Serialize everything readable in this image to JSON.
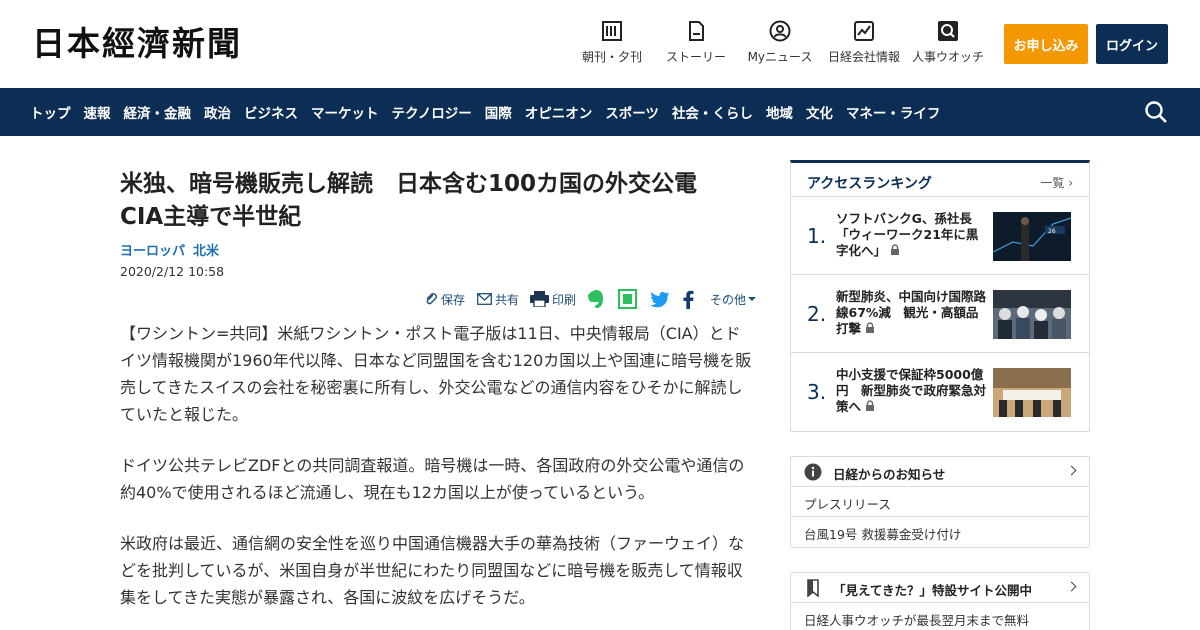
{
  "header": {
    "logo": "日本經濟新聞",
    "nav": [
      {
        "label": "朝刊・夕刊",
        "icon": "newspaper-icon"
      },
      {
        "label": "ストーリー",
        "icon": "document-icon"
      },
      {
        "label": "Myニュース",
        "icon": "user-icon"
      },
      {
        "label": "日経会社情報",
        "icon": "chart-icon"
      },
      {
        "label": "人事ウオッチ",
        "icon": "search-person-icon"
      }
    ],
    "apply_label": "お申し込み",
    "login_label": "ログイン"
  },
  "navbar": {
    "items": [
      "トップ",
      "速報",
      "経済・金融",
      "政治",
      "ビジネス",
      "マーケット",
      "テクノロジー",
      "国際",
      "オピニオン",
      "スポーツ",
      "社会・くらし",
      "地域",
      "文化",
      "マネー・ライフ"
    ],
    "search_icon": "search-icon"
  },
  "article": {
    "title": "米独、暗号機販売し解読　日本含む100カ国の外交公電　CIA主導で半世紀",
    "tags": [
      "ヨーロッパ",
      "北米"
    ],
    "date": "2020/2/12 10:58",
    "tools": {
      "save": "保存",
      "share": "共有",
      "print": "印刷",
      "more": "その他"
    },
    "paragraphs": [
      "【ワシントン=共同】米紙ワシントン・ポスト電子版は11日、中央情報局（CIA）とドイツ情報機関が1960年代以降、日本など同盟国を含む120カ国以上や国連に暗号機を販売してきたスイスの会社を秘密裏に所有し、外交公電などの通信内容をひそかに解読していたと報じた。",
      "ドイツ公共テレビZDFとの共同調査報道。暗号機は一時、各国政府の外交公電や通信の約40%で使用されるほど流通し、現在も12カ国以上が使っているという。",
      "米政府は最近、通信網の安全性を巡り中国通信機器大手の華為技術（ファーウェイ）などを批判しているが、米国自身が半世紀にわたり同盟国などに暗号機を販売して情報収集をしてきた実態が暴露され、各国に波紋を広げそうだ。"
    ]
  },
  "ranking": {
    "title": "アクセスランキング",
    "more": "一覧",
    "items": [
      {
        "rank": "1.",
        "headline": "ソフトバンクG、孫社長「ウィーワーク21年に黒字化へ」"
      },
      {
        "rank": "2.",
        "headline": "新型肺炎、中国向け国際路線67%減　観光・高額品打撃"
      },
      {
        "rank": "3.",
        "headline": "中小支援で保証枠5000億円　新型肺炎で政府緊急対策へ"
      }
    ]
  },
  "notice": {
    "title": "日経からのお知らせ",
    "items": [
      "プレスリリース",
      "台風19号 救援募金受け付け"
    ]
  },
  "promo": {
    "title": "「見えてきた？」特設サイト公開中",
    "items": [
      "日経人事ウオッチが最長翌月末まで無料"
    ]
  },
  "colors": {
    "navy": "#0c2e55",
    "orange": "#f39800",
    "link": "#1d6fb0"
  }
}
